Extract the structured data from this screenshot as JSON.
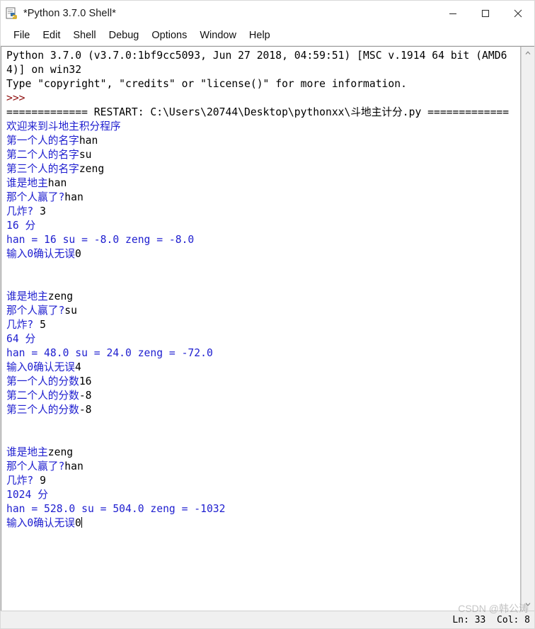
{
  "window": {
    "title": "*Python 3.7.0 Shell*",
    "icon": "idle-python-icon",
    "minimize_label": "—",
    "maximize_label": "□",
    "close_label": "✕"
  },
  "menu": {
    "items": [
      {
        "label": "File"
      },
      {
        "label": "Edit"
      },
      {
        "label": "Shell"
      },
      {
        "label": "Debug"
      },
      {
        "label": "Options"
      },
      {
        "label": "Window"
      },
      {
        "label": "Help"
      }
    ]
  },
  "console": {
    "lines": [
      {
        "segments": [
          {
            "text": "Python 3.7.0 (v3.7.0:1bf9cc5093, Jun 27 2018, 04:59:51) [MSC v.1914 64 bit (AMD64)] on win32",
            "color": "black"
          }
        ]
      },
      {
        "segments": [
          {
            "text": "Type \"copyright\", \"credits\" or \"license()\" for more information.",
            "color": "black"
          }
        ]
      },
      {
        "segments": [
          {
            "text": ">>>",
            "color": "red"
          }
        ]
      },
      {
        "segments": [
          {
            "text": "============= RESTART: C:\\Users\\20744\\Desktop\\pythonxx\\斗地主计分.py =============",
            "color": "black"
          }
        ]
      },
      {
        "segments": [
          {
            "text": "欢迎来到斗地主积分程序",
            "color": "blue"
          }
        ]
      },
      {
        "segments": [
          {
            "text": "第一个人的名字",
            "color": "blue"
          },
          {
            "text": "han",
            "color": "black"
          }
        ]
      },
      {
        "segments": [
          {
            "text": "第二个人的名字",
            "color": "blue"
          },
          {
            "text": "su",
            "color": "black"
          }
        ]
      },
      {
        "segments": [
          {
            "text": "第三个人的名字",
            "color": "blue"
          },
          {
            "text": "zeng",
            "color": "black"
          }
        ]
      },
      {
        "segments": [
          {
            "text": "谁是地主",
            "color": "blue"
          },
          {
            "text": "han",
            "color": "black"
          }
        ]
      },
      {
        "segments": [
          {
            "text": "那个人赢了?",
            "color": "blue"
          },
          {
            "text": "han",
            "color": "black"
          }
        ]
      },
      {
        "segments": [
          {
            "text": "几炸? ",
            "color": "blue"
          },
          {
            "text": "3",
            "color": "black"
          }
        ]
      },
      {
        "segments": [
          {
            "text": "16 分",
            "color": "blue"
          }
        ]
      },
      {
        "segments": [
          {
            "text": "han = 16 su = -8.0 zeng = -8.0",
            "color": "blue"
          }
        ]
      },
      {
        "segments": [
          {
            "text": "输入0确认无误",
            "color": "blue"
          },
          {
            "text": "0",
            "color": "black"
          }
        ]
      },
      {
        "segments": []
      },
      {
        "segments": []
      },
      {
        "segments": [
          {
            "text": "谁是地主",
            "color": "blue"
          },
          {
            "text": "zeng",
            "color": "black"
          }
        ]
      },
      {
        "segments": [
          {
            "text": "那个人赢了?",
            "color": "blue"
          },
          {
            "text": "su",
            "color": "black"
          }
        ]
      },
      {
        "segments": [
          {
            "text": "几炸? ",
            "color": "blue"
          },
          {
            "text": "5",
            "color": "black"
          }
        ]
      },
      {
        "segments": [
          {
            "text": "64 分",
            "color": "blue"
          }
        ]
      },
      {
        "segments": [
          {
            "text": "han = 48.0 su = 24.0 zeng = -72.0",
            "color": "blue"
          }
        ]
      },
      {
        "segments": [
          {
            "text": "输入0确认无误",
            "color": "blue"
          },
          {
            "text": "4",
            "color": "black"
          }
        ]
      },
      {
        "segments": [
          {
            "text": "第一个人的分数",
            "color": "blue"
          },
          {
            "text": "16",
            "color": "black"
          }
        ]
      },
      {
        "segments": [
          {
            "text": "第二个人的分数",
            "color": "blue"
          },
          {
            "text": "-8",
            "color": "black"
          }
        ]
      },
      {
        "segments": [
          {
            "text": "第三个人的分数",
            "color": "blue"
          },
          {
            "text": "-8",
            "color": "black"
          }
        ]
      },
      {
        "segments": []
      },
      {
        "segments": []
      },
      {
        "segments": [
          {
            "text": "谁是地主",
            "color": "blue"
          },
          {
            "text": "zeng",
            "color": "black"
          }
        ]
      },
      {
        "segments": [
          {
            "text": "那个人赢了?",
            "color": "blue"
          },
          {
            "text": "han",
            "color": "black"
          }
        ]
      },
      {
        "segments": [
          {
            "text": "几炸? ",
            "color": "blue"
          },
          {
            "text": "9",
            "color": "black"
          }
        ]
      },
      {
        "segments": [
          {
            "text": "1024 分",
            "color": "blue"
          }
        ]
      },
      {
        "segments": [
          {
            "text": "han = 528.0 su = 504.0 zeng = -1032",
            "color": "blue"
          }
        ]
      },
      {
        "segments": [
          {
            "text": "输入0确认无误",
            "color": "blue"
          },
          {
            "text": "0",
            "color": "black"
          }
        ],
        "caret": true
      }
    ]
  },
  "scrollbar": {
    "up_arrow": "chevron-up-icon",
    "down_arrow": "chevron-down-icon"
  },
  "statusbar": {
    "position": "Ln: 33  Col: 8",
    "watermark": "CSDN @韩公涛"
  },
  "colors": {
    "output_blue": "#2020d0",
    "prompt_red": "#8f1010",
    "input_black": "#000000"
  }
}
